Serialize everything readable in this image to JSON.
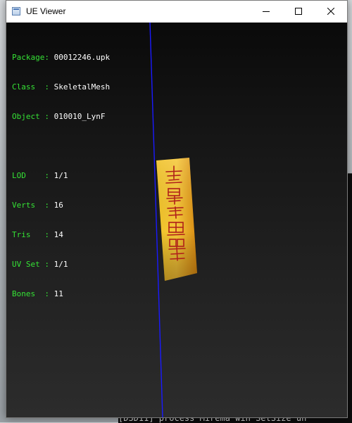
{
  "window": {
    "title": "UE Viewer"
  },
  "info": {
    "package_label": "Package",
    "package_value": "00012246.upk",
    "class_label": "Class  ",
    "class_value": "SkeletalMesh",
    "object_label": "Object ",
    "object_value": "010010_LynF",
    "lod_label": "LOD    ",
    "lod_value": "1/1",
    "verts_label": "Verts  ",
    "verts_value": "16",
    "tris_label": "Tris   ",
    "tris_value": "14",
    "uvset_label": "UV Set ",
    "uvset_value": "1/1",
    "bones_label": "Bones  ",
    "bones_value": "11"
  },
  "console": {
    "bottom_line": "[D3D11] process  Mirema win SetSize  un"
  },
  "colors": {
    "info_key": "#35e335",
    "info_value": "#ffffff",
    "axis": "#1a1aff",
    "talisman_paper": "#e8a81c",
    "talisman_ink": "#b0201a"
  },
  "icons": {
    "app": "app-window-icon",
    "minimize": "minimize-icon",
    "maximize": "maximize-icon",
    "close": "close-icon"
  }
}
